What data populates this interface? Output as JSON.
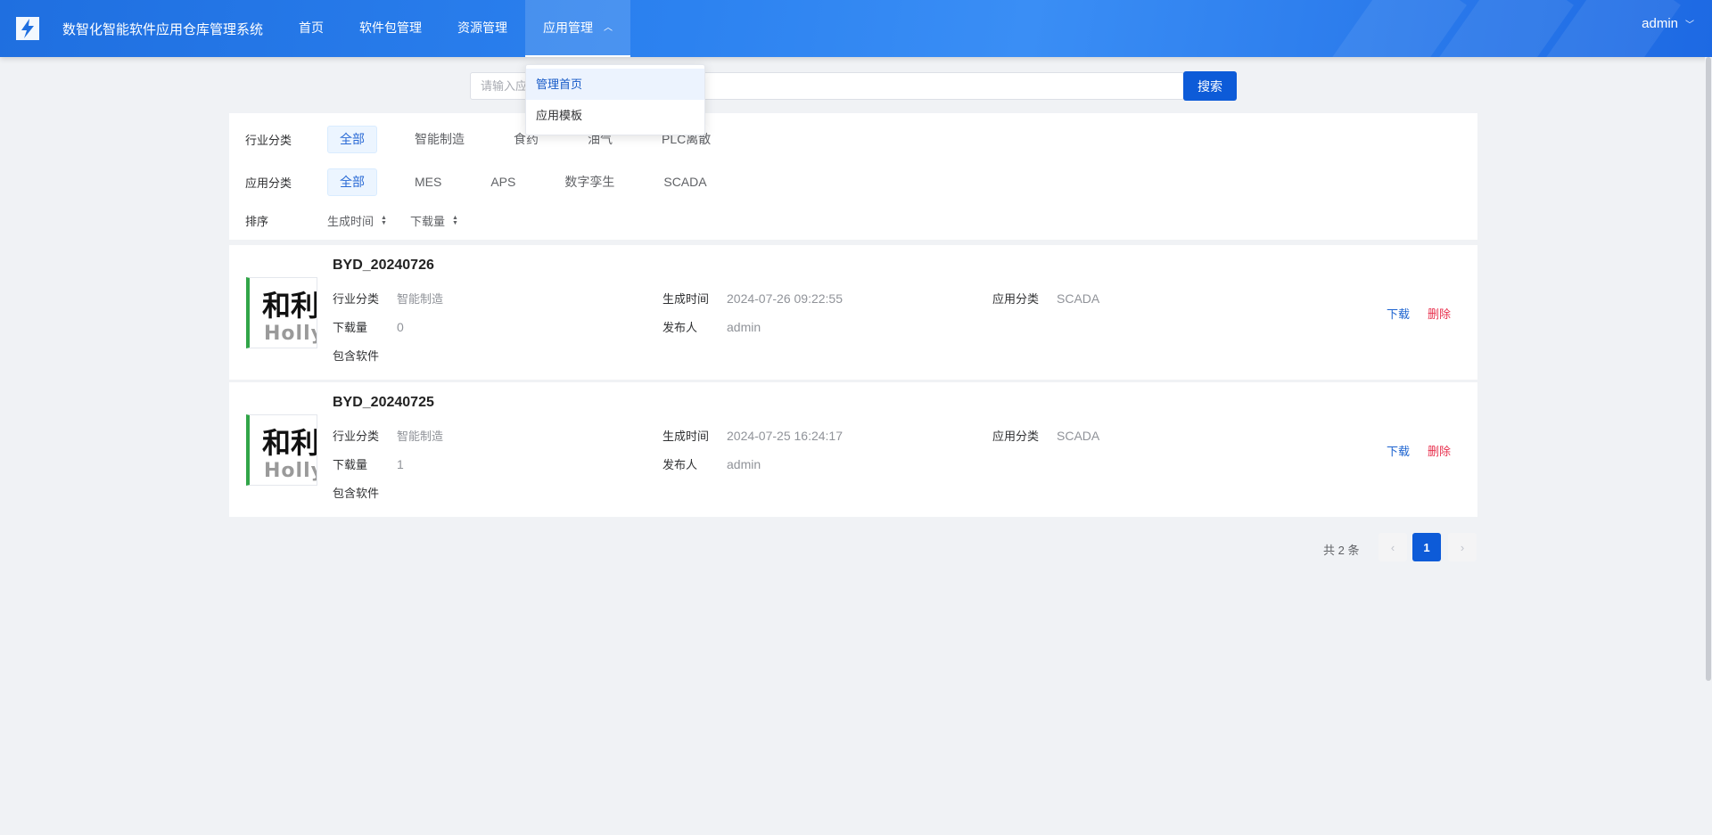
{
  "header": {
    "app_title": "数智化智能软件应用仓库管理系统",
    "logo_icon": "lightning-logo-icon",
    "nav": [
      {
        "label": "首页"
      },
      {
        "label": "软件包管理"
      },
      {
        "label": "资源管理"
      },
      {
        "label": "应用管理",
        "active": true
      }
    ],
    "user": "admin"
  },
  "dropdown": {
    "items": [
      {
        "label": "管理首页",
        "active": true
      },
      {
        "label": "应用模板"
      }
    ]
  },
  "search": {
    "placeholder": "请输入应用名称",
    "button": "搜索"
  },
  "filters": {
    "industry": {
      "label": "行业分类",
      "options": [
        "全部",
        "智能制造",
        "食药",
        "油气",
        "PLC离散"
      ],
      "selected": "全部"
    },
    "app_type": {
      "label": "应用分类",
      "options": [
        "全部",
        "MES",
        "APS",
        "数字孪生",
        "SCADA"
      ],
      "selected": "全部"
    },
    "sort": {
      "label": "排序",
      "options": [
        "生成时间",
        "下载量"
      ]
    }
  },
  "field_labels": {
    "industry": "行业分类",
    "created": "生成时间",
    "app_type": "应用分类",
    "downloads": "下载量",
    "publisher": "发布人",
    "software": "包含软件"
  },
  "thumb": {
    "glyph_text": "和利",
    "brand_text": "Holly"
  },
  "apps": [
    {
      "name": "BYD_20240726",
      "industry": "智能制造",
      "created": "2024-07-26 09:22:55",
      "app_type": "SCADA",
      "downloads": "0",
      "publisher": "admin",
      "download_label": "下载",
      "delete_label": "删除"
    },
    {
      "name": "BYD_20240725",
      "industry": "智能制造",
      "created": "2024-07-25 16:24:17",
      "app_type": "SCADA",
      "downloads": "1",
      "publisher": "admin",
      "download_label": "下载",
      "delete_label": "删除"
    }
  ],
  "pagination": {
    "total": "共 2 条",
    "current": "1",
    "prev_icon": "chevron-left-icon",
    "next_icon": "chevron-right-icon"
  },
  "colors": {
    "header_start": "#1f6fe0",
    "header_end": "#1d69e3",
    "primary": "#0d5bd8",
    "danger": "#e8324f",
    "thumb_accent": "#31a548"
  }
}
